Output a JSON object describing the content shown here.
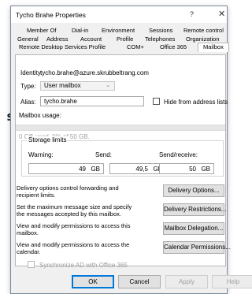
{
  "background": {
    "partial_text": "s"
  },
  "window": {
    "title": "Tycho Brahe Properties",
    "help_glyph": "?",
    "close_glyph": "✕"
  },
  "tabs": {
    "row1": [
      "Member Of",
      "Dial-in",
      "Environment",
      "Sessions",
      "Remote control"
    ],
    "row2": [
      "General",
      "Address",
      "Account",
      "Profile",
      "Telephones",
      "Organization"
    ],
    "row3": [
      "Remote Desktop Services Profile",
      "COM+",
      "Office 365",
      "Mailbox"
    ],
    "active": "Mailbox"
  },
  "identity": {
    "label": "Identity:",
    "value": "tycho.brahe@azure.skrubbeltrang.com"
  },
  "type": {
    "label": "Type:",
    "value": "User mailbox"
  },
  "alias": {
    "label": "Alias:",
    "value": "tycho.brahe"
  },
  "hide_from_lists": {
    "label": "Hide from address lists",
    "checked": false
  },
  "usage": {
    "label": "Mailbox usage:",
    "text": "0 GB used, 0% of 50 GB.",
    "fraction": 0.0
  },
  "storage_limits": {
    "title": "Storage limits",
    "warning": {
      "label": "Warning:",
      "value": "49",
      "unit": "GB"
    },
    "send": {
      "label": "Send:",
      "value": "49,5",
      "unit": "GB"
    },
    "send_receive": {
      "label": "Send/receive:",
      "value": "50",
      "unit": "GB"
    }
  },
  "options": [
    {
      "description": "Delivery options control forwarding and recipient limits.",
      "button": "Delivery Options..."
    },
    {
      "description": "Set the maximum message size and specify the messages accepted by this mailbox.",
      "button": "Delivery Restrictions..."
    },
    {
      "description": "View and modify permissions to access this mailbox.",
      "button": "Mailbox Delegation..."
    },
    {
      "description": "View and modify permissions to access the calendar.",
      "button": "Calendar Permissions..."
    }
  ],
  "sync": {
    "label": "Synchronize AD with Office 365",
    "checked": false
  },
  "footer": {
    "ok": "OK",
    "cancel": "Cancel",
    "apply": "Apply",
    "help": "Help"
  },
  "colors": {
    "accent": "#0078d7",
    "usage_bar": "#3a9a3a"
  }
}
